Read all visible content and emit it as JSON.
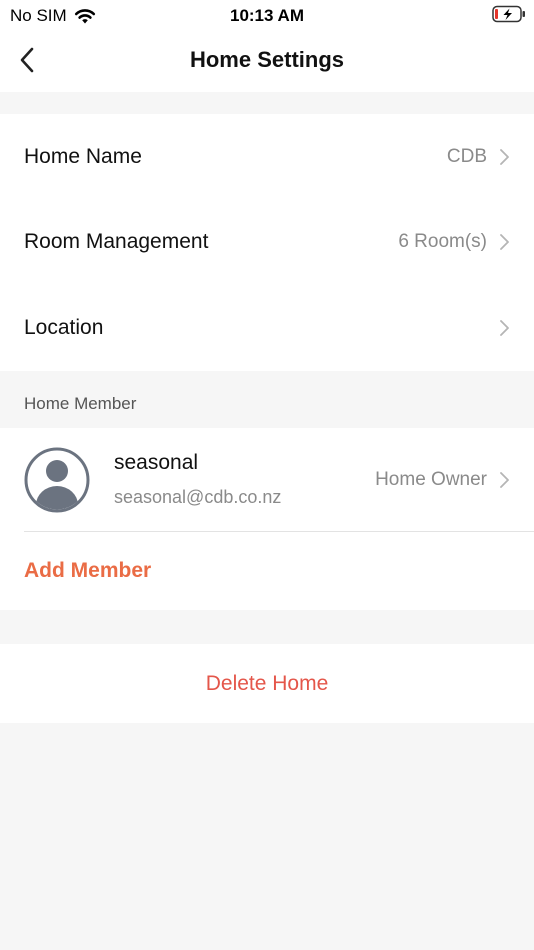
{
  "status_bar": {
    "carrier": "No SIM",
    "time": "10:13 AM"
  },
  "nav": {
    "title": "Home Settings"
  },
  "settings": {
    "home_name": {
      "label": "Home Name",
      "value": "CDB"
    },
    "room_management": {
      "label": "Room Management",
      "value": "6 Room(s)"
    },
    "location": {
      "label": "Location"
    }
  },
  "members": {
    "header": "Home Member",
    "items": [
      {
        "name": "seasonal",
        "email": "seasonal@cdb.co.nz",
        "role": "Home Owner"
      }
    ],
    "add_label": "Add Member"
  },
  "actions": {
    "delete_label": "Delete Home"
  },
  "colors": {
    "accent": "#ea6c45",
    "danger": "#e4564a",
    "background": "#f6f6f6",
    "secondary_text": "#8a8a8a"
  },
  "icons": [
    "wifi-icon",
    "battery-charging-icon",
    "back-icon",
    "chevron-right-icon",
    "avatar-icon"
  ]
}
